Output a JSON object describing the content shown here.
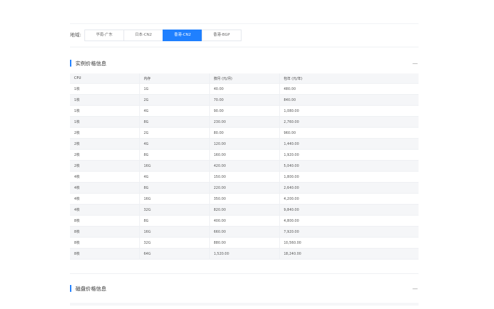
{
  "region": {
    "label": "地域:",
    "tabs": [
      {
        "label": "华南-广东",
        "active": false
      },
      {
        "label": "日本-CN2",
        "active": false
      },
      {
        "label": "香港-CN2",
        "active": true
      },
      {
        "label": "香港-BGP",
        "active": false
      }
    ]
  },
  "instance_section": {
    "title": "实例价格信息",
    "collapse_symbol": "—",
    "columns": [
      "CPU",
      "内存",
      "按月 (元/月)",
      "包年 (元/年)"
    ],
    "rows": [
      [
        "1核",
        "1G",
        "40.00",
        "480.00"
      ],
      [
        "1核",
        "2G",
        "70.00",
        "840.00"
      ],
      [
        "1核",
        "4G",
        "90.00",
        "1,080.00"
      ],
      [
        "1核",
        "8G",
        "230.00",
        "2,760.00"
      ],
      [
        "2核",
        "2G",
        "80.00",
        "960.00"
      ],
      [
        "2核",
        "4G",
        "120.00",
        "1,440.00"
      ],
      [
        "2核",
        "8G",
        "160.00",
        "1,920.00"
      ],
      [
        "2核",
        "16G",
        "420.00",
        "5,040.00"
      ],
      [
        "4核",
        "4G",
        "150.00",
        "1,800.00"
      ],
      [
        "4核",
        "8G",
        "220.00",
        "2,640.00"
      ],
      [
        "4核",
        "16G",
        "350.00",
        "4,200.00"
      ],
      [
        "4核",
        "32G",
        "820.00",
        "9,840.00"
      ],
      [
        "8核",
        "8G",
        "400.00",
        "4,800.00"
      ],
      [
        "8核",
        "16G",
        "660.00",
        "7,920.00"
      ],
      [
        "8核",
        "32G",
        "880.00",
        "10,560.00"
      ],
      [
        "8核",
        "64G",
        "1,520.00",
        "18,240.00"
      ]
    ]
  },
  "disk_section": {
    "title": "磁盘价格信息",
    "collapse_symbol": "—"
  },
  "colors": {
    "accent": "#1f80ff",
    "row_alt": "#f5f6f8",
    "border": "#eef0f3"
  }
}
